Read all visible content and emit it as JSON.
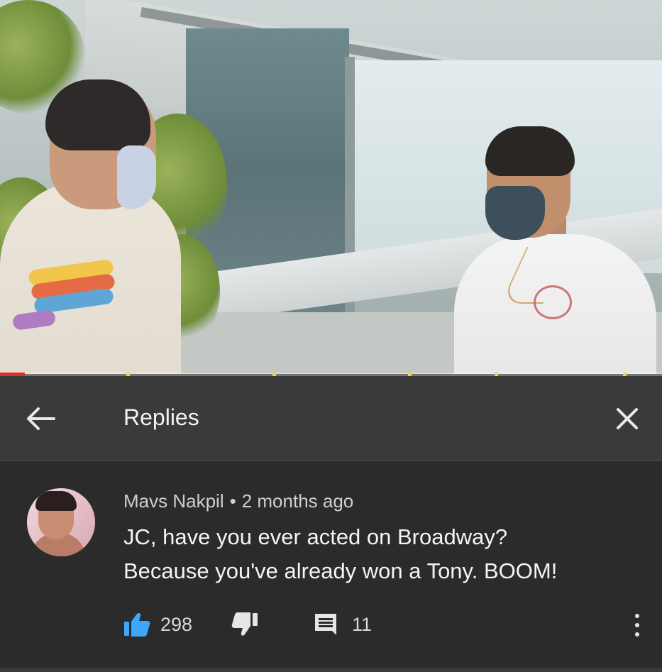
{
  "video": {
    "progress_fraction": 0.038,
    "colors": {
      "played": "#e32b2b",
      "ad_marker": "#f3d53c"
    }
  },
  "header": {
    "title": "Replies",
    "back_icon": "arrow-left-icon",
    "close_icon": "close-icon"
  },
  "comment": {
    "author": "Mavs Nakpil",
    "separator": "•",
    "time": "2 months ago",
    "lines": [
      "JC, have you ever acted on Broadway?",
      "Because you've already won a Tony. BOOM!"
    ],
    "likes": "298",
    "replies": "11",
    "icons": {
      "like": "thumbs-up-icon",
      "dislike": "thumbs-down-icon",
      "reply": "comment-icon",
      "more": "more-vertical-icon"
    },
    "colors": {
      "like_active": "#3ea6ff"
    }
  }
}
